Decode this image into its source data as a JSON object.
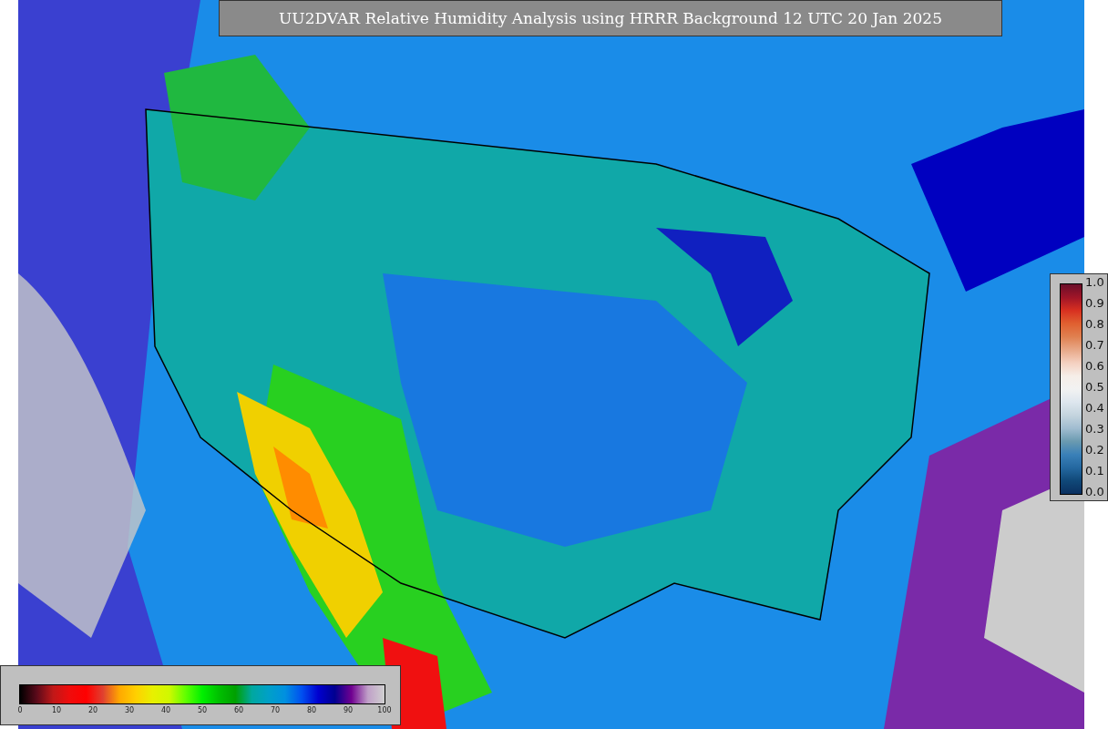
{
  "title": "UU2DVAR Relative Humidity Analysis using HRRR Background 12 UTC 20 Jan 2025",
  "humidity_colorbar": {
    "ticks": [
      "0",
      "10",
      "20",
      "30",
      "40",
      "50",
      "60",
      "70",
      "80",
      "90",
      "100"
    ]
  },
  "ratio_colorbar": {
    "ticks": [
      "1.0",
      "0.9",
      "0.8",
      "0.7",
      "0.6",
      "0.5",
      "0.4",
      "0.3",
      "0.2",
      "0.1",
      "0.0"
    ]
  }
}
